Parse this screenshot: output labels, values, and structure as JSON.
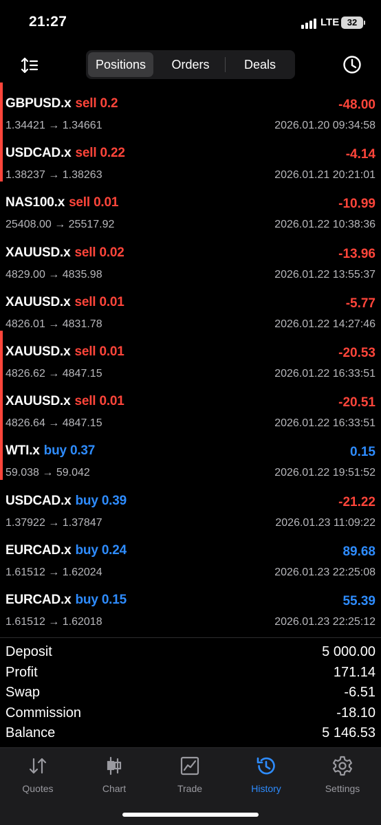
{
  "status_bar": {
    "time": "21:27",
    "network": "LTE",
    "battery": "32"
  },
  "tabs": {
    "positions": "Positions",
    "orders": "Orders",
    "deals": "Deals",
    "active": "positions"
  },
  "colors": {
    "sell": "#ff453a",
    "buy": "#2e8cff",
    "accent": "#2e8cff",
    "background": "#000000"
  },
  "deals": [
    {
      "symbol": "GBPUSD.x",
      "direction": "sell",
      "volume": "0.2",
      "open_price": "1.34421",
      "close_price": "1.34661",
      "profit": "-48.00",
      "time": "2026.01.20 09:34:58",
      "marked": true
    },
    {
      "symbol": "USDCAD.x",
      "direction": "sell",
      "volume": "0.22",
      "open_price": "1.38237",
      "close_price": "1.38263",
      "profit": "-4.14",
      "time": "2026.01.21 20:21:01",
      "marked": true
    },
    {
      "symbol": "NAS100.x",
      "direction": "sell",
      "volume": "0.01",
      "open_price": "25408.00",
      "close_price": "25517.92",
      "profit": "-10.99",
      "time": "2026.01.22 10:38:36",
      "marked": false
    },
    {
      "symbol": "XAUUSD.x",
      "direction": "sell",
      "volume": "0.02",
      "open_price": "4829.00",
      "close_price": "4835.98",
      "profit": "-13.96",
      "time": "2026.01.22 13:55:37",
      "marked": false
    },
    {
      "symbol": "XAUUSD.x",
      "direction": "sell",
      "volume": "0.01",
      "open_price": "4826.01",
      "close_price": "4831.78",
      "profit": "-5.77",
      "time": "2026.01.22 14:27:46",
      "marked": false
    },
    {
      "symbol": "XAUUSD.x",
      "direction": "sell",
      "volume": "0.01",
      "open_price": "4826.62",
      "close_price": "4847.15",
      "profit": "-20.53",
      "time": "2026.01.22 16:33:51",
      "marked": true
    },
    {
      "symbol": "XAUUSD.x",
      "direction": "sell",
      "volume": "0.01",
      "open_price": "4826.64",
      "close_price": "4847.15",
      "profit": "-20.51",
      "time": "2026.01.22 16:33:51",
      "marked": true
    },
    {
      "symbol": "WTI.x",
      "direction": "buy",
      "volume": "0.37",
      "open_price": "59.038",
      "close_price": "59.042",
      "profit": "0.15",
      "time": "2026.01.22 19:51:52",
      "marked": true
    },
    {
      "symbol": "USDCAD.x",
      "direction": "buy",
      "volume": "0.39",
      "open_price": "1.37922",
      "close_price": "1.37847",
      "profit": "-21.22",
      "time": "2026.01.23 11:09:22",
      "marked": false
    },
    {
      "symbol": "EURCAD.x",
      "direction": "buy",
      "volume": "0.24",
      "open_price": "1.61512",
      "close_price": "1.62024",
      "profit": "89.68",
      "time": "2026.01.23 22:25:08",
      "marked": false
    },
    {
      "symbol": "EURCAD.x",
      "direction": "buy",
      "volume": "0.15",
      "open_price": "1.61512",
      "close_price": "1.62018",
      "profit": "55.39",
      "time": "2026.01.23 22:25:12",
      "marked": false
    }
  ],
  "summary": [
    {
      "label": "Deposit",
      "value": "5 000.00"
    },
    {
      "label": "Profit",
      "value": "171.14"
    },
    {
      "label": "Swap",
      "value": "-6.51"
    },
    {
      "label": "Commission",
      "value": "-18.10"
    },
    {
      "label": "Balance",
      "value": "5 146.53"
    }
  ],
  "bottom_nav": [
    {
      "label": "Quotes",
      "icon": "quotes-arrows-icon",
      "active": false
    },
    {
      "label": "Chart",
      "icon": "candlestick-chart-icon",
      "active": false
    },
    {
      "label": "Trade",
      "icon": "trade-chart-icon",
      "active": false
    },
    {
      "label": "History",
      "icon": "history-clock-icon",
      "active": true
    },
    {
      "label": "Settings",
      "icon": "gear-icon",
      "active": false
    }
  ]
}
